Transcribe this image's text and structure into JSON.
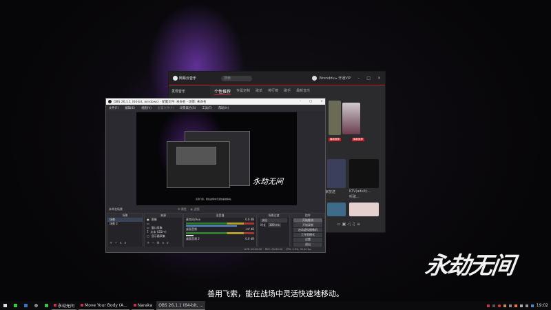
{
  "netease": {
    "logo": "网易云音乐",
    "search_placeholder": "搜索",
    "user": "Wrenddu ▸ 开通VIP",
    "sidebar_item": "发现音乐",
    "tabs": [
      "个性推荐",
      "专属定制",
      "歌单",
      "排行榜",
      "歌手",
      "最新音乐"
    ],
    "badges": [
      "最新推荐",
      "最新推荐"
    ],
    "captions": [
      "KTV(adult)...",
      "听歌...",
      "独家放送"
    ]
  },
  "obs": {
    "title": "OBS 26.1.1 (64-bit, windows) - 配置文件: 未命名 - 场景: 未命名",
    "menu": [
      "文件(F)",
      "编辑(E)",
      "视图(V)",
      "配置文件(P)",
      "场景集合(S)",
      "工具(T)",
      "帮助(H)"
    ],
    "scene_label": "未命名场景",
    "props_btn": "属性",
    "filters_btn": "滤镜",
    "docks": {
      "scenes": "场景",
      "sources": "来源",
      "mixer": "混音器",
      "transitions": "场景过渡",
      "controls": "控件"
    },
    "scenes": [
      "场景",
      "场景 2"
    ],
    "sources": [
      "图像",
      "",
      "窗口采集",
      "文本 (GDI+)",
      "显示器采集"
    ],
    "mixer": [
      {
        "name": "麦克风/Aux",
        "db": "0.0 dB"
      },
      {
        "name": "桌面音频",
        "db": "-inf dB"
      },
      {
        "name": "桌面音频 2",
        "db": "0.0 dB"
      }
    ],
    "transition": "淡出",
    "duration_label": "时长",
    "duration": "300 ms",
    "controls": [
      "开始推流",
      "开始录制",
      "启动虚拟摄像机",
      "工作室模式",
      "设置",
      "退出"
    ],
    "status": [
      "LIVE: 00:00:00",
      "REC: 00:00:00",
      "CPU: 2.9%, 30.00 fps"
    ]
  },
  "game_logo": "永劫无间",
  "subtitle": "善用飞索，能在战场中灵活快速地移动。",
  "taskbar": {
    "items": [
      "永劫无间",
      "Move Your Body (A...",
      "Naraka",
      "OBS 26.1.1 (64-bit, ..."
    ],
    "clock": "19:02"
  }
}
